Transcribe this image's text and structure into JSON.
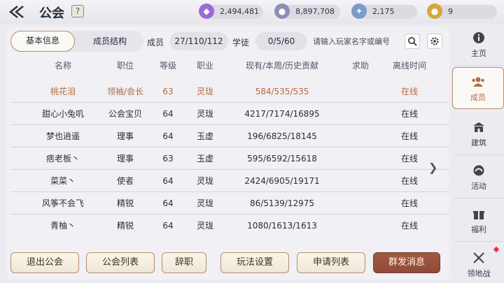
{
  "header": {
    "title": "公会",
    "help": "?",
    "resources": [
      {
        "icon": "purple-crystal-icon",
        "value": "2,494,481",
        "color": "#9a6bd6"
      },
      {
        "icon": "silver-coin-icon",
        "value": "8,897,708",
        "color": "#8c8fb8"
      },
      {
        "icon": "guild-badge-icon",
        "value": "2,175",
        "color": "#7b9cc8"
      },
      {
        "icon": "gold-coin-icon",
        "value": "9",
        "color": "#d6a53c"
      }
    ]
  },
  "tabs": {
    "basic": "基本信息",
    "structure": "成员结构"
  },
  "info": {
    "members_label": "成员",
    "members_value": "27/110/112",
    "apprentice_label": "学徒",
    "apprentice_value": "0/5/60",
    "search_placeholder": "请输入玩家名字或编号"
  },
  "columns": {
    "name": "名称",
    "position": "职位",
    "level": "等级",
    "job": "职业",
    "contribution": "现有/本周/历史贡献",
    "help": "求助",
    "offline": "离线时间"
  },
  "members": [
    {
      "name": "桃花泪",
      "position": "领袖/会长",
      "level": "63",
      "job": "灵珑",
      "contribution": "584/535/535",
      "help": "",
      "offline": "在线"
    },
    {
      "name": "甜心小兔叽",
      "position": "公会宝贝",
      "level": "64",
      "job": "灵珑",
      "contribution": "4217/7174/16895",
      "help": "",
      "offline": "在线"
    },
    {
      "name": "梦也逍遥",
      "position": "理事",
      "level": "64",
      "job": "玉虚",
      "contribution": "196/6825/18145",
      "help": "",
      "offline": "在线"
    },
    {
      "name": "痞老板丶",
      "position": "理事",
      "level": "63",
      "job": "玉虚",
      "contribution": "595/6592/15618",
      "help": "",
      "offline": "在线"
    },
    {
      "name": "菜菜丶",
      "position": "使者",
      "level": "64",
      "job": "灵珑",
      "contribution": "2424/6905/19171",
      "help": "",
      "offline": "在线"
    },
    {
      "name": "风筝不会飞",
      "position": "精锐",
      "level": "64",
      "job": "灵珑",
      "contribution": "86/5139/12975",
      "help": "",
      "offline": "在线"
    },
    {
      "name": "青柚丶",
      "position": "精锐",
      "level": "64",
      "job": "灵珑",
      "contribution": "1080/1613/1613",
      "help": "",
      "offline": "在线"
    }
  ],
  "buttons": {
    "quit": "退出公会",
    "guild_list": "公会列表",
    "resign": "辞职",
    "gameplay": "玩法设置",
    "applications": "申请列表",
    "broadcast": "群发消息"
  },
  "sidebar": {
    "items": [
      {
        "label": "主页",
        "icon": "info-icon"
      },
      {
        "label": "成员",
        "icon": "members-icon"
      },
      {
        "label": "建筑",
        "icon": "building-icon"
      },
      {
        "label": "活动",
        "icon": "activity-icon"
      },
      {
        "label": "福利",
        "icon": "gift-icon"
      },
      {
        "label": "领地战",
        "icon": "crossed-swords-icon"
      }
    ]
  }
}
